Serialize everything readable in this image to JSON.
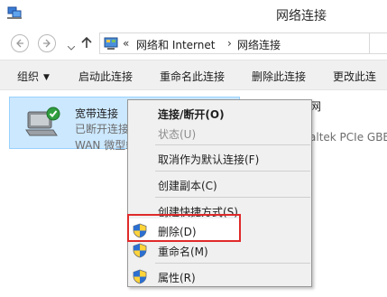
{
  "window": {
    "title": "网络连接",
    "app_icon": "network-connections-icon"
  },
  "address_bar": {
    "prefix": "«",
    "crumbs": [
      "网络和 Internet",
      "网络连接"
    ],
    "separator": "›"
  },
  "command_bar": {
    "items": [
      "组织",
      "启动此连接",
      "重命名此连接",
      "删除此连接",
      "更改此连"
    ],
    "organize_caret": "▼"
  },
  "connections": [
    {
      "name": "宽带连接",
      "status": "已断开连接",
      "device": "WAN 微型端",
      "icon": "broadband-connection-icon",
      "selected": true
    },
    {
      "name": "太网",
      "device": "altek PCIe GBE",
      "icon": "ethernet-icon",
      "selected": false
    }
  ],
  "context_menu": {
    "items": [
      {
        "label": "连接/断开(O)",
        "style": "bold",
        "shield": false
      },
      {
        "label": "状态(U)",
        "style": "disabled",
        "shield": false
      },
      {
        "label": "取消作为默认连接(F)",
        "style": "normal",
        "shield": false
      },
      {
        "label": "创建副本(C)",
        "style": "normal",
        "shield": false
      },
      {
        "label": "创建快捷方式(S)",
        "style": "normal",
        "shield": false
      },
      {
        "label": "删除(D)",
        "style": "normal",
        "shield": true
      },
      {
        "label": "重命名(M)",
        "style": "normal",
        "shield": true
      },
      {
        "label": "属性(R)",
        "style": "normal",
        "shield": true
      }
    ],
    "highlighted_item": "删除(D)",
    "highlight_color": "#e02a2a"
  },
  "colors": {
    "selection_bg": "#cce8ff",
    "selection_border": "#99d1ff",
    "menu_bg": "#f0f0f0"
  }
}
